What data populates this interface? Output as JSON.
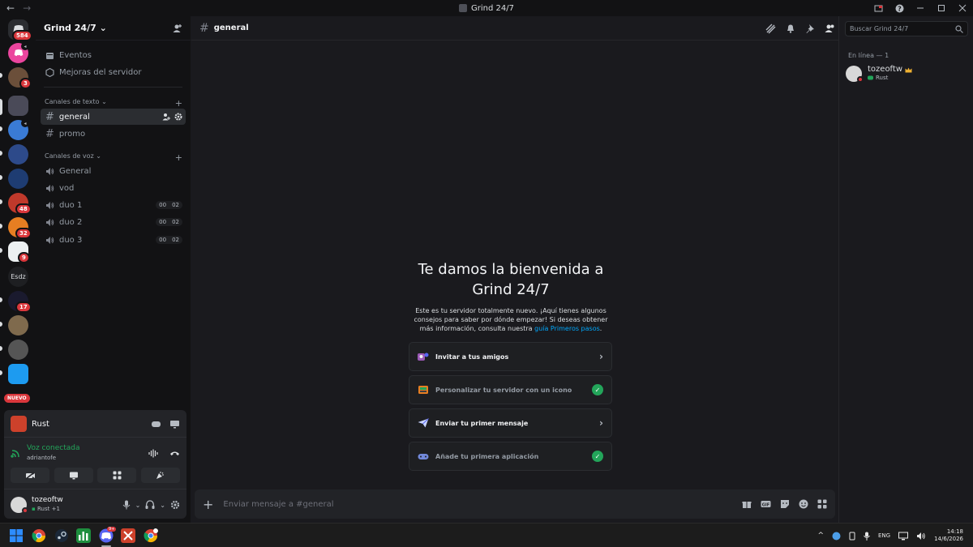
{
  "window": {
    "title": "Grind 24/7",
    "back": "←",
    "forward": "→"
  },
  "servers": {
    "dm_badge": "584",
    "badges": [
      "3",
      "48",
      "32",
      "9",
      "17"
    ],
    "esdz_label": "Esdz",
    "new_label": "NUEVO"
  },
  "sidebar": {
    "server_name": "Grind 24/7",
    "events": "Eventos",
    "boosts": "Mejoras del servidor",
    "text_category": "Canales de texto",
    "text_channels": [
      "general",
      "promo"
    ],
    "voice_category": "Canales de voz",
    "voice_channels": [
      {
        "name": "General"
      },
      {
        "name": "vod"
      },
      {
        "name": "duo 1",
        "a": "00",
        "b": "02"
      },
      {
        "name": "duo 2",
        "a": "00",
        "b": "02"
      },
      {
        "name": "duo 3",
        "a": "00",
        "b": "02"
      }
    ]
  },
  "panel": {
    "game": "Rust",
    "voice_status": "Voz conectada",
    "voice_user": "adriantofe",
    "username": "tozeoftw",
    "user_status": "Rust +1"
  },
  "chat": {
    "channel": "general",
    "welcome_title": "Te damos la bienvenida a Grind 24/7",
    "welcome_text": "Este es tu servidor totalmente nuevo. ¡Aquí tienes algunos consejos para saber por dónde empezar! Si deseas obtener más información, consulta nuestra",
    "welcome_link": "guía Primeros pasos",
    "welcome_end": ".",
    "cards": [
      {
        "label": "Invitar a tus amigos",
        "done": false
      },
      {
        "label": "Personalizar tu servidor con un icono",
        "done": true
      },
      {
        "label": "Enviar tu primer mensaje",
        "done": false
      },
      {
        "label": "Añade tu primera aplicación",
        "done": true
      }
    ],
    "composer_placeholder": "Enviar mensaje a #general"
  },
  "members": {
    "search_placeholder": "Buscar Grind 24/7",
    "online_header": "En línea — 1",
    "member_name": "tozeoftw",
    "member_activity": "Rust"
  },
  "taskbar": {
    "lang": "ENG",
    "time": "14:18",
    "date": "14/6/2026",
    "discord_badge": "9+"
  },
  "colors": {
    "accent": "#5865f2",
    "online": "#23a55a",
    "danger": "#da373c",
    "link": "#00a8fc"
  }
}
